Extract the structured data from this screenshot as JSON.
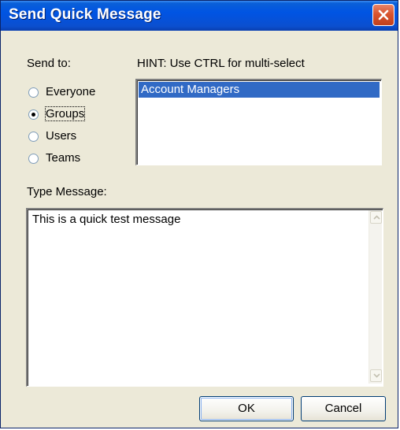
{
  "window": {
    "title": "Send Quick Message"
  },
  "send_to": {
    "label": "Send to:",
    "hint": "HINT: Use CTRL for multi-select",
    "options": [
      {
        "label": "Everyone",
        "selected": false
      },
      {
        "label": "Groups",
        "selected": true
      },
      {
        "label": "Users",
        "selected": false
      },
      {
        "label": "Teams",
        "selected": false
      }
    ],
    "list_items": [
      {
        "label": "Account Managers",
        "selected": true
      }
    ]
  },
  "message": {
    "label": "Type Message:",
    "value": "This is a quick test message"
  },
  "buttons": {
    "ok_label": "OK",
    "cancel_label": "Cancel"
  },
  "icons": {
    "close": "close-icon",
    "scroll_up": "chevron-up-icon",
    "scroll_down": "chevron-down-icon"
  },
  "colors": {
    "titlebar": "#0054e3",
    "close_button": "#d8542f",
    "selection": "#316ac5",
    "dialog_background": "#ece9d8"
  }
}
